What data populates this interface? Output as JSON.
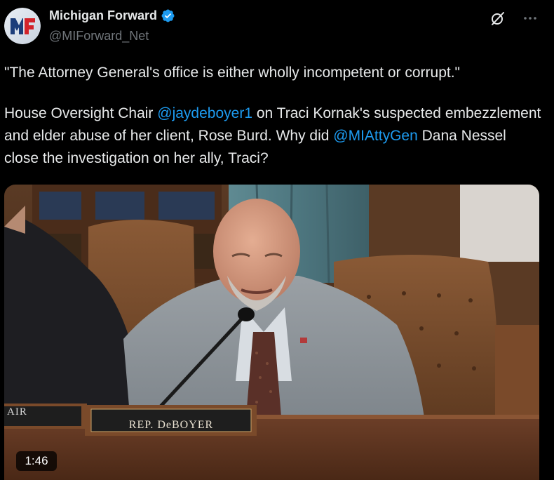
{
  "author": {
    "display_name": "Michigan Forward",
    "handle": "@MIForward_Net",
    "avatar_text": "MF",
    "verified": true
  },
  "tweet": {
    "line1": "\"The Attorney General's office is either wholly incompetent or corrupt.\"",
    "p2_a": "House Oversight Chair ",
    "mention1": "@jaydeboyer1",
    "p2_b": " on Traci Kornak's suspected embezzlement and elder abuse of her client, Rose Burd. Why did ",
    "mention2": "@MIAttyGen",
    "p2_c": " Dana Nessel close the investigation on her ally, Traci?"
  },
  "video": {
    "duration": "1:46",
    "nameplate": "REP. DeBOYER",
    "left_nameplate": "AIR"
  },
  "colors": {
    "accent": "#1d9bf0",
    "background": "#000000",
    "text": "#e7e9ea",
    "muted": "#71767b"
  },
  "icons": [
    "grok-icon",
    "more-icon",
    "verified-icon"
  ]
}
